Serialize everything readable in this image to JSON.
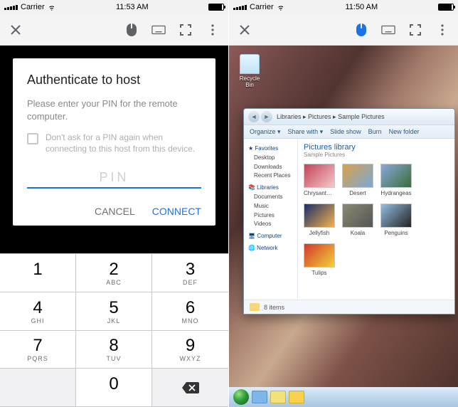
{
  "left": {
    "status": {
      "carrier": "Carrier",
      "time": "11:53 AM"
    },
    "dialog": {
      "title": "Authenticate to host",
      "subtitle": "Please enter your PIN for the remote computer.",
      "checkbox_label": "Don't ask for a PIN again when connecting to this host from this device.",
      "pin_placeholder": "PIN",
      "cancel": "CANCEL",
      "connect": "CONNECT"
    },
    "keypad": [
      {
        "n": "1",
        "l": ""
      },
      {
        "n": "2",
        "l": "ABC"
      },
      {
        "n": "3",
        "l": "DEF"
      },
      {
        "n": "4",
        "l": "GHI"
      },
      {
        "n": "5",
        "l": "JKL"
      },
      {
        "n": "6",
        "l": "MNO"
      },
      {
        "n": "7",
        "l": "PQRS"
      },
      {
        "n": "8",
        "l": "TUV"
      },
      {
        "n": "9",
        "l": "WXYZ"
      },
      {
        "n": "",
        "l": ""
      },
      {
        "n": "0",
        "l": ""
      },
      {
        "n": "del",
        "l": ""
      }
    ]
  },
  "right": {
    "status": {
      "carrier": "Carrier",
      "time": "11:50 AM"
    },
    "desktop": {
      "recycle": "Recycle Bin"
    },
    "explorer": {
      "breadcrumb": "Libraries ▸ Pictures ▸ Sample Pictures",
      "toolbar": [
        "Organize ▾",
        "Share with ▾",
        "Slide show",
        "Burn",
        "New folder"
      ],
      "sidebar": {
        "favorites": {
          "hdr": "Favorites",
          "items": [
            "Desktop",
            "Downloads",
            "Recent Places"
          ]
        },
        "libraries": {
          "hdr": "Libraries",
          "items": [
            "Documents",
            "Music",
            "Pictures",
            "Videos"
          ]
        },
        "computer": "Computer",
        "network": "Network"
      },
      "library_title": "Pictures library",
      "library_sub": "Sample Pictures",
      "items": [
        {
          "name": "Chrysanthemum",
          "c1": "#c1445a",
          "c2": "#f7c7c7"
        },
        {
          "name": "Desert",
          "c1": "#d9a24a",
          "c2": "#7aa7d8"
        },
        {
          "name": "Hydrangeas",
          "c1": "#8aa8d8",
          "c2": "#3a6d3a"
        },
        {
          "name": "Jellyfish",
          "c1": "#1a2f6a",
          "c2": "#f2b24a"
        },
        {
          "name": "Koala",
          "c1": "#8a8a72",
          "c2": "#555"
        },
        {
          "name": "Penguins",
          "c1": "#94bde2",
          "c2": "#222"
        },
        {
          "name": "Tulips",
          "c1": "#d2392a",
          "c2": "#f2d13a"
        }
      ],
      "footer": "8 items"
    }
  }
}
